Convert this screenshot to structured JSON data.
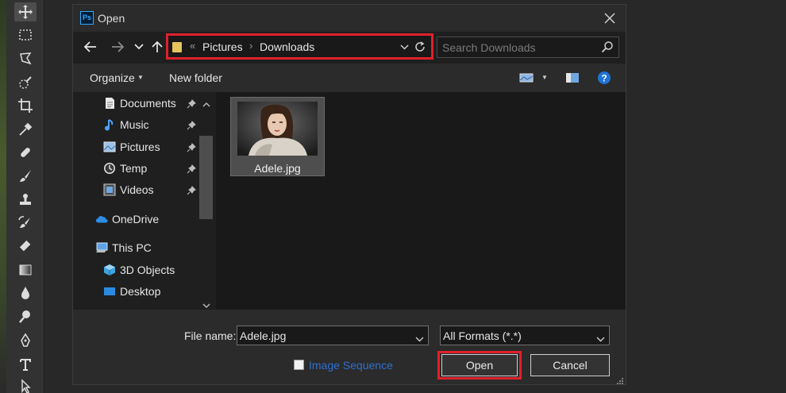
{
  "dialog": {
    "title": "Open",
    "app_logo": "Ps"
  },
  "navigation": {
    "breadcrumb": [
      "Pictures",
      "Downloads"
    ],
    "overflow_marker": "«",
    "search_placeholder": "Search Downloads"
  },
  "commandbar": {
    "organize_label": "Organize",
    "new_folder_label": "New folder"
  },
  "sidebar": {
    "items": [
      {
        "label": "Documents",
        "icon": "documents-icon",
        "pinned": true
      },
      {
        "label": "Music",
        "icon": "music-icon",
        "pinned": true
      },
      {
        "label": "Pictures",
        "icon": "pictures-icon",
        "pinned": true
      },
      {
        "label": "Temp",
        "icon": "clock-icon",
        "pinned": true
      },
      {
        "label": "Videos",
        "icon": "videos-icon",
        "pinned": true
      },
      {
        "label": "OneDrive",
        "icon": "cloud-icon",
        "pinned": false
      },
      {
        "label": "This PC",
        "icon": "computer-icon",
        "pinned": false
      },
      {
        "label": "3D Objects",
        "icon": "cube-icon",
        "pinned": false
      },
      {
        "label": "Desktop",
        "icon": "desktop-icon",
        "pinned": false
      }
    ]
  },
  "files": [
    {
      "name": "Adele.jpg",
      "selected": true
    }
  ],
  "footer": {
    "file_name_label": "File name:",
    "file_name_value": "Adele.jpg",
    "filter_value": "All Formats (*.*)",
    "image_sequence_label": "Image Sequence",
    "open_label": "Open",
    "cancel_label": "Cancel"
  },
  "colors": {
    "highlight": "#e0202c",
    "link": "#2f6fd0",
    "ps_accent": "#31a8ff"
  }
}
